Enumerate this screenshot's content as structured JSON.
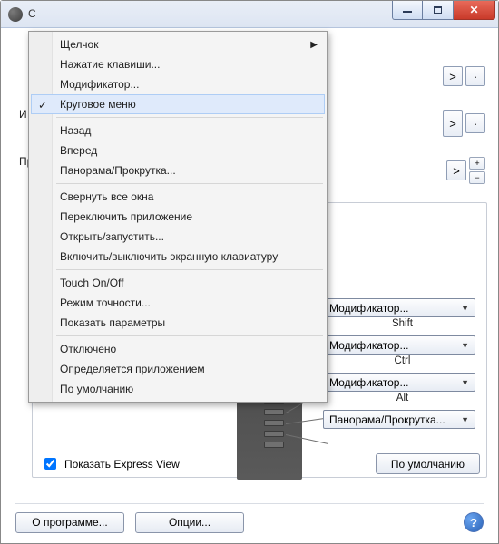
{
  "window": {
    "title_fragment": "С"
  },
  "side_labels": {
    "label_a": "И",
    "label_b": "Пр"
  },
  "right_buttons": {
    "gt": ">",
    "dot": "·",
    "plus": "+",
    "minus": "−"
  },
  "context_menu": {
    "items": [
      {
        "label": "Щелчок",
        "has_submenu": true
      },
      {
        "label": "Нажатие клавиши..."
      },
      {
        "label": "Модификатор..."
      },
      {
        "label": "Круговое меню",
        "checked": true,
        "selected": true
      }
    ],
    "items2": [
      {
        "label": "Назад"
      },
      {
        "label": "Вперед"
      },
      {
        "label": "Панорама/Прокрутка..."
      }
    ],
    "items3": [
      {
        "label": "Свернуть все окна"
      },
      {
        "label": "Переключить приложение"
      },
      {
        "label": "Открыть/запустить..."
      },
      {
        "label": "Включить/выключить экранную клавиатуру"
      }
    ],
    "items4": [
      {
        "label": "Touch On/Off"
      },
      {
        "label": "Режим точности..."
      },
      {
        "label": "Показать параметры"
      }
    ],
    "items5": [
      {
        "label": "Отключено"
      },
      {
        "label": "Определяется приложением"
      },
      {
        "label": "По умолчанию"
      }
    ]
  },
  "modifiers": [
    {
      "combo": "Модификатор...",
      "sub": "Shift"
    },
    {
      "combo": "Модификатор...",
      "sub": "Ctrl"
    },
    {
      "combo": "Модификатор...",
      "sub": "Alt"
    },
    {
      "combo": "Панорама/Прокрутка...",
      "sub": ""
    }
  ],
  "checkbox": {
    "label": "Показать Express View",
    "checked": true
  },
  "buttons": {
    "default": "По умолчанию",
    "about": "О программе...",
    "options": "Опции...",
    "help": "?"
  }
}
